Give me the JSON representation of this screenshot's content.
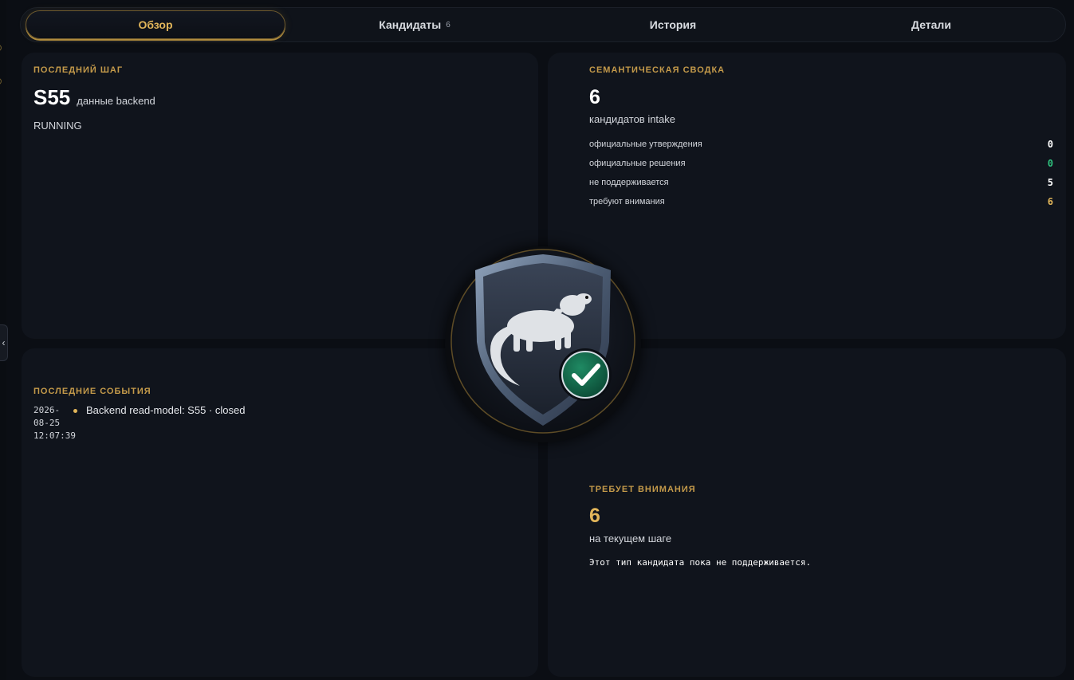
{
  "tabs": [
    {
      "label": "Обзор",
      "active": true
    },
    {
      "label": "Кандидаты",
      "count": "6"
    },
    {
      "label": "История"
    },
    {
      "label": "Детали"
    }
  ],
  "last_step": {
    "title": "ПОСЛЕДНИЙ ШАГ",
    "step": "S55",
    "step_desc": "данные backend",
    "status": "RUNNING"
  },
  "semantic_summary": {
    "title": "СЕМАНТИЧЕСКАЯ СВОДКА",
    "count": "6",
    "count_label": "кандидатов intake",
    "rows": [
      {
        "label": "официальные утверждения",
        "value": "0",
        "color": "#ffffff"
      },
      {
        "label": "официальные решения",
        "value": "0",
        "color": "#2fc37f"
      },
      {
        "label": "не поддерживается",
        "value": "5",
        "color": "#ffffff"
      },
      {
        "label": "требуют внимания",
        "value": "6",
        "color": "#e2b65a"
      }
    ]
  },
  "recent_events": {
    "title": "ПОСЛЕДНИЕ СОБЫТИЯ",
    "items": [
      {
        "time_line1": "2026-",
        "time_line2": "08-25",
        "time_line3": "12:07:39",
        "text": "Backend read-model: S55 · closed"
      }
    ]
  },
  "attention": {
    "title": "ТРЕБУЕТ ВНИМАНИЯ",
    "count": "6",
    "count_label": "на текущем шаге",
    "note": "Этот тип кандидата пока не поддерживается."
  },
  "emblem": {
    "icon": "ermine-shield-check-icon"
  },
  "colors": {
    "accent": "#e2b65a",
    "success": "#2fc37f",
    "panel": "#10141c",
    "background": "#0b0e14"
  }
}
